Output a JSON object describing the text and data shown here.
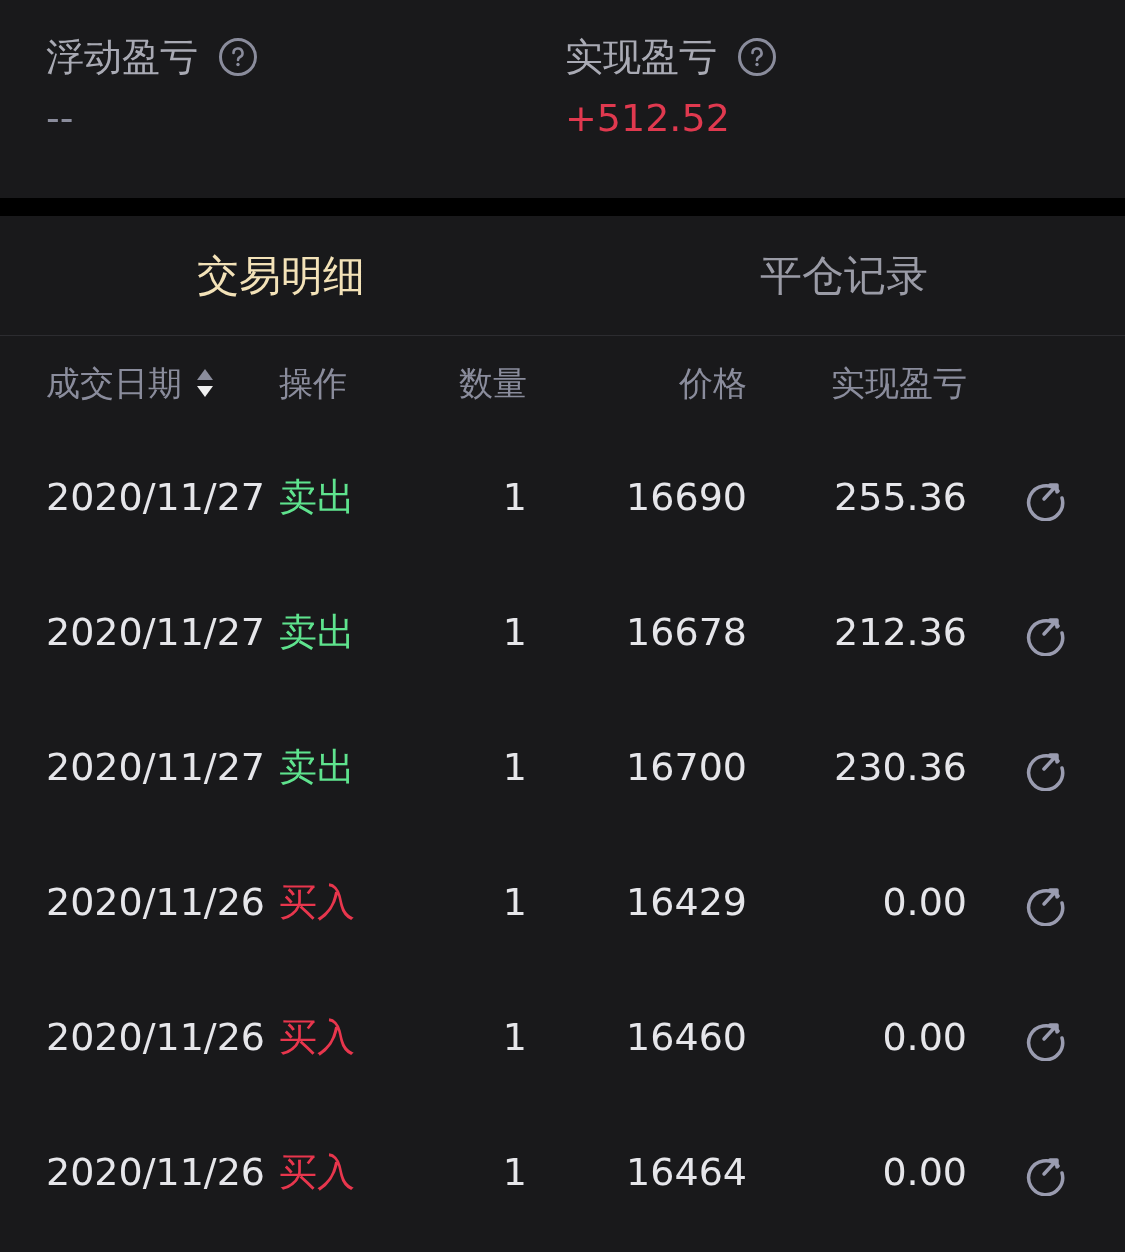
{
  "summary": [
    {
      "label": "浮动盈亏",
      "value": "--",
      "kind": "neutral"
    },
    {
      "label": "实现盈亏",
      "value": "+512.52",
      "kind": "profit"
    }
  ],
  "tabs": [
    {
      "label": "交易明细",
      "selected": true
    },
    {
      "label": "平仓记录",
      "selected": false
    }
  ],
  "table": {
    "columns": [
      "成交日期",
      "操作",
      "数量",
      "价格",
      "实现盈亏"
    ],
    "sort_descending": true,
    "rows": [
      {
        "date": "2020/11/27",
        "action": "卖出",
        "kind": "sell",
        "qty": "1",
        "price": "16690",
        "pnl": "255.36"
      },
      {
        "date": "2020/11/27",
        "action": "卖出",
        "kind": "sell",
        "qty": "1",
        "price": "16678",
        "pnl": "212.36"
      },
      {
        "date": "2020/11/27",
        "action": "卖出",
        "kind": "sell",
        "qty": "1",
        "price": "16700",
        "pnl": "230.36"
      },
      {
        "date": "2020/11/26",
        "action": "买入",
        "kind": "buy",
        "qty": "1",
        "price": "16429",
        "pnl": "0.00"
      },
      {
        "date": "2020/11/26",
        "action": "买入",
        "kind": "buy",
        "qty": "1",
        "price": "16460",
        "pnl": "0.00"
      },
      {
        "date": "2020/11/26",
        "action": "买入",
        "kind": "buy",
        "qty": "1",
        "price": "16464",
        "pnl": "0.00"
      }
    ]
  }
}
